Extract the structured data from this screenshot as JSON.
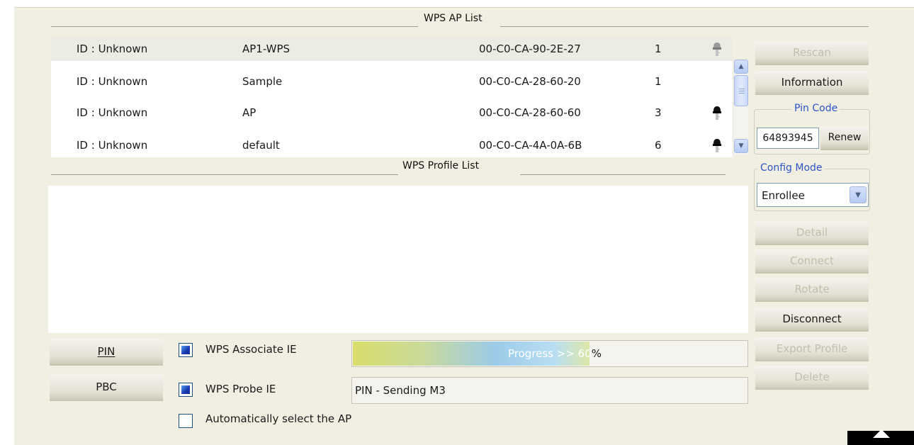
{
  "ap_list": {
    "title": "WPS AP List",
    "rows": [
      {
        "id": "ID : Unknown",
        "ssid": "AP1-WPS",
        "bssid": "00-C0-CA-90-2E-27",
        "channel": "1",
        "icon": "lock-key-icon",
        "selected": true
      },
      {
        "id": "ID : Unknown",
        "ssid": "Sample",
        "bssid": "00-C0-CA-28-60-20",
        "channel": "1",
        "icon": "",
        "selected": false
      },
      {
        "id": "ID : Unknown",
        "ssid": "AP",
        "bssid": "00-C0-CA-28-60-60",
        "channel": "3",
        "icon": "lock-key-icon",
        "selected": false
      },
      {
        "id": "ID : Unknown",
        "ssid": "default",
        "bssid": "00-C0-CA-4A-0A-6B",
        "channel": "6",
        "icon": "lock-key-icon",
        "selected": false
      }
    ]
  },
  "profile_list": {
    "title": "WPS Profile List"
  },
  "right_panel": {
    "rescan": "Rescan",
    "information": "Information",
    "pin_code_label": "Pin Code",
    "pin_code_value": "64893945",
    "renew": "Renew",
    "config_mode_label": "Config Mode",
    "config_mode_value": "Enrollee",
    "detail": "Detail",
    "connect": "Connect",
    "rotate": "Rotate",
    "disconnect": "Disconnect",
    "export_profile": "Export Profile",
    "delete": "Delete"
  },
  "bottom": {
    "pin_button": "PIN",
    "pbc_button": "PBC",
    "wps_associate_ie": "WPS Associate IE",
    "wps_probe_ie": "WPS Probe IE",
    "auto_select_ap": "Automatically select the AP",
    "progress_text": "Progress >> 60",
    "progress_suffix": "%",
    "progress_fraction": 0.6,
    "status_text": "PIN - Sending M3"
  },
  "colors": {
    "accent": "#2b55c9",
    "panel_bg": "#f1efe2",
    "checkbox_fill": "#1c3fb8"
  }
}
